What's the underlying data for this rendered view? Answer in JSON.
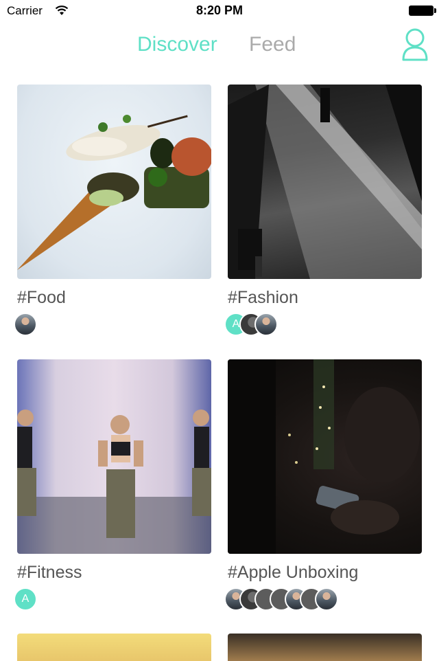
{
  "status_bar": {
    "carrier": "Carrier",
    "time": "8:20 PM"
  },
  "nav": {
    "tabs": [
      {
        "label": "Discover",
        "active": true
      },
      {
        "label": "Feed",
        "active": false
      }
    ],
    "accent_color": "#5fe0c6",
    "inactive_color": "#aaaaaa",
    "profile_icon": "person-outline-icon"
  },
  "cards": [
    {
      "title": "#Food",
      "avatars": [
        {
          "type": "photo"
        }
      ]
    },
    {
      "title": "#Fashion",
      "avatars": [
        {
          "type": "letter",
          "letter": "A"
        },
        {
          "type": "dark"
        },
        {
          "type": "photo"
        }
      ]
    },
    {
      "title": "#Fitness",
      "avatars": [
        {
          "type": "letter",
          "letter": "A"
        }
      ]
    },
    {
      "title": "#Apple Unboxing",
      "avatars": [
        {
          "type": "photo"
        },
        {
          "type": "dark"
        },
        {
          "type": "gray"
        },
        {
          "type": "gray"
        },
        {
          "type": "photo"
        },
        {
          "type": "gray"
        },
        {
          "type": "photo"
        }
      ]
    }
  ]
}
